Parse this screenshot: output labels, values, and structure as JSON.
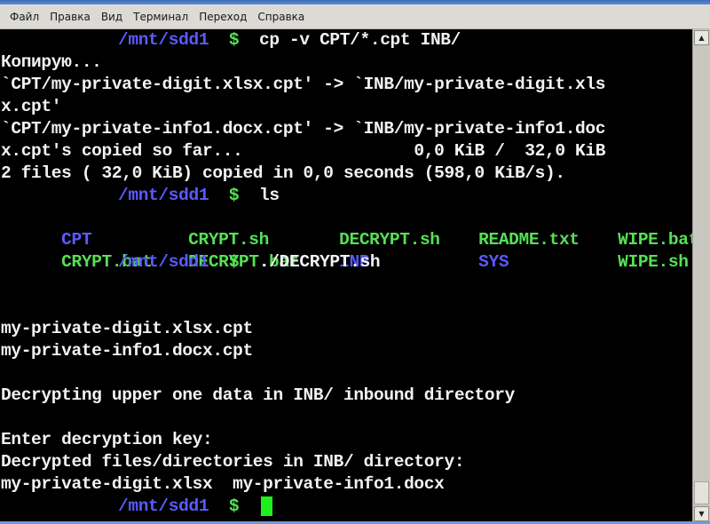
{
  "window": {
    "menu": [
      "Файл",
      "Правка",
      "Вид",
      "Терминал",
      "Переход",
      "Справка"
    ]
  },
  "prompt": {
    "path": "/mnt/sdd1",
    "symbol": "$"
  },
  "terminal": {
    "cmd1": "cp -v CPT/*.cpt INB/",
    "out1": [
      "Копирую...",
      "`CPT/my-private-digit.xlsx.cpt' -> `INB/my-private-digit.xls",
      "x.cpt'",
      "`CPT/my-private-info1.docx.cpt' -> `INB/my-private-info1.doc",
      "x.cpt's copied so far...                 0,0 KiB /  32,0 KiB",
      "2 files ( 32,0 KiB) copied in 0,0 seconds (598,0 KiB/s)."
    ],
    "cmd2": "ls",
    "ls_rows": [
      [
        {
          "name": "CPT",
          "color": "blue"
        },
        {
          "name": "CRYPT.sh",
          "color": "green"
        },
        {
          "name": "DECRYPT.sh",
          "color": "green"
        },
        {
          "name": "README.txt",
          "color": "green"
        },
        {
          "name": "WIPE.bat",
          "color": "green"
        }
      ],
      [
        {
          "name": "CRYPT.bat",
          "color": "green"
        },
        {
          "name": "DECRYPT.bat",
          "color": "green"
        },
        {
          "name": "INB",
          "color": "blue"
        },
        {
          "name": "SYS",
          "color": "blue"
        },
        {
          "name": "WIPE.sh",
          "color": "green"
        }
      ]
    ],
    "cmd3": "./DECRYPT.sh",
    "out3": [
      "",
      "",
      "my-private-digit.xlsx.cpt",
      "my-private-info1.docx.cpt",
      "",
      "Decrypting upper one data in INB/ inbound directory",
      "",
      "Enter decryption key:",
      "Decrypted files/directories in INB/ directory:",
      "my-private-digit.xlsx  my-private-info1.docx"
    ]
  },
  "colors": {
    "background": "#000000",
    "text": "#f2f2f2",
    "prompt_path": "#5a5aff",
    "prompt_symbol": "#55e055",
    "executable": "#55e055",
    "directory": "#5a5aff",
    "cursor": "#1ef01e"
  }
}
